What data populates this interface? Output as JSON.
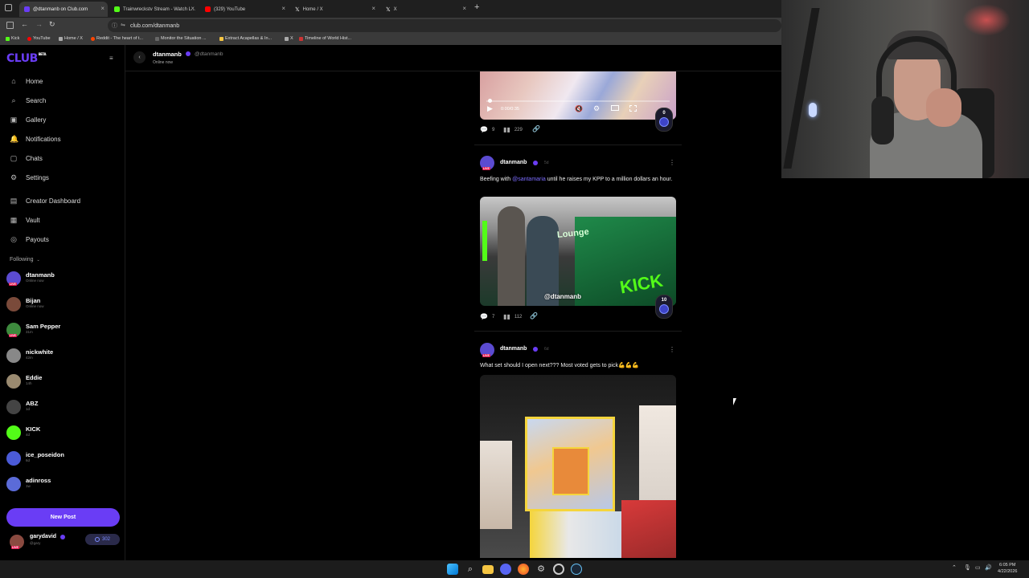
{
  "browser": {
    "tabs": [
      {
        "title": "@dtanmanb on Club.com",
        "color": "#6a3df5"
      },
      {
        "title": "Trainwreckstv Stream - Watch L...",
        "color": "#53fc18"
      },
      {
        "title": "(329) YouTube",
        "color": "#ff0000"
      },
      {
        "title": "Home / X",
        "color": "#ffffff"
      },
      {
        "title": "X",
        "color": "#ffffff"
      }
    ],
    "url": "club.com/dtanmanb",
    "bookmarks": [
      "Kick",
      "YouTube",
      "Home / X",
      "Reddit - The heart of t...",
      "Monitor the Situation ...",
      "Extract Acapellas & In...",
      "X",
      "Timeline of World Hist..."
    ]
  },
  "app": {
    "logo": "CLUB",
    "logo_tag": "BETA",
    "accent": "#6a3df5"
  },
  "sidebar": {
    "nav": [
      {
        "label": "Home",
        "icon": "home-icon",
        "glyph": "⌂"
      },
      {
        "label": "Search",
        "icon": "search-icon",
        "glyph": "⌕"
      },
      {
        "label": "Gallery",
        "icon": "gallery-icon",
        "glyph": "▣"
      },
      {
        "label": "Notifications",
        "icon": "bell-icon",
        "glyph": "🔔"
      },
      {
        "label": "Chats",
        "icon": "chat-icon",
        "glyph": "▢"
      },
      {
        "label": "Settings",
        "icon": "gear-icon",
        "glyph": "⚙"
      },
      {
        "label": "Creator Dashboard",
        "icon": "dashboard-icon",
        "glyph": "▤"
      },
      {
        "label": "Vault",
        "icon": "vault-icon",
        "glyph": "▦"
      },
      {
        "label": "Payouts",
        "icon": "payout-icon",
        "glyph": "◎"
      }
    ],
    "following_label": "Following",
    "following": [
      {
        "name": "dtanmanb",
        "status": "Online now",
        "live": true,
        "color": "#5b4bd1"
      },
      {
        "name": "Bijan",
        "status": "Online now",
        "live": false,
        "color": "#7a4a3a"
      },
      {
        "name": "Sam Pepper",
        "status": "31m",
        "live": true,
        "color": "#3d8a3d"
      },
      {
        "name": "nickwhite",
        "status": "42m",
        "live": false,
        "color": "#888888"
      },
      {
        "name": "Eddie",
        "status": "14h",
        "live": false,
        "color": "#9a8a70"
      },
      {
        "name": "ABZ",
        "status": "1d",
        "live": false,
        "color": "#444444"
      },
      {
        "name": "KICK",
        "status": "4d",
        "live": false,
        "color": "#53fc18"
      },
      {
        "name": "ice_poseidon",
        "status": "6d",
        "live": false,
        "color": "#4b5bd8"
      },
      {
        "name": "adinross",
        "status": "1w",
        "live": false,
        "color": "#5b6bd8"
      }
    ],
    "new_post": "New Post",
    "user": {
      "name": "garydavid",
      "handle": "@gary",
      "balance": "302"
    }
  },
  "profile_header": {
    "name": "dtanmanb",
    "handle": "@dtanmanb",
    "status": "Online now"
  },
  "posts": [
    {
      "video_time": "0:00/0:35",
      "comments": "9",
      "views": "229",
      "score": "0"
    },
    {
      "author": "dtanmanb",
      "time": "5d",
      "text_before": "Beefing with ",
      "mention": "@santamaria",
      "text_after": " until he raises my KPP to a million dollars an hour.",
      "image_caption": "Lounge",
      "watermark": "@dtanmanb",
      "comments": "7",
      "views": "112",
      "score": "10"
    },
    {
      "author": "dtanmanb",
      "time": "6d",
      "text": "What set should I open next??? Most voted gets to pick💪💪💪"
    }
  ],
  "taskbar": {
    "time": "6:05 PM",
    "date": "4/22/2026"
  }
}
